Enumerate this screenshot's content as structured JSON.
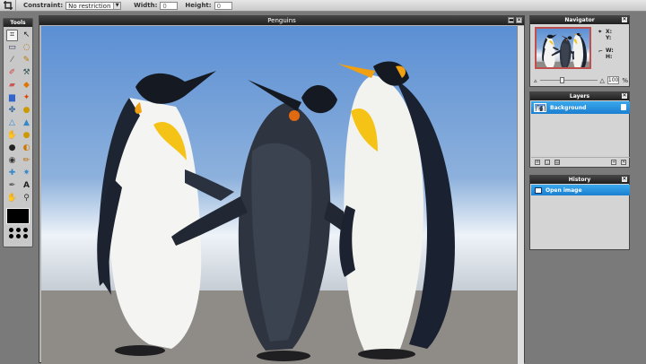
{
  "options": {
    "constraint_label": "Constraint:",
    "constraint_value": "No restriction",
    "width_label": "Width:",
    "width_value": "0",
    "height_label": "Height:",
    "height_value": "0"
  },
  "tools": {
    "title": "Tools",
    "icons": [
      "crop-icon",
      "move-icon",
      "marquee-icon",
      "lasso-icon",
      "wand-icon",
      "pencil-icon",
      "brush-icon",
      "clone-stamp-icon",
      "eraser-icon",
      "fill-bucket-icon",
      "gradient-icon",
      "color-replace-icon",
      "sponge-icon",
      "drop-icon",
      "sharpen-icon",
      "blur-icon",
      "smudge-icon",
      "dodge-icon",
      "burn-icon",
      "red-eye-icon",
      "bloat-icon",
      "pinch-icon",
      "eyedropper-icon",
      "text-icon",
      "hand-icon",
      "zoom-icon"
    ]
  },
  "canvas": {
    "title": "Penguins"
  },
  "navigator": {
    "title": "Navigator",
    "x_label": "X:",
    "y_label": "Y:",
    "w_label": "W:",
    "h_label": "H:",
    "zoom_value": "100",
    "zoom_unit": "%"
  },
  "layers": {
    "title": "Layers",
    "items": [
      {
        "name": "Background"
      }
    ]
  },
  "history": {
    "title": "History",
    "items": [
      {
        "name": "Open image"
      }
    ]
  },
  "colors": {
    "titlebar": "#2a2a2a",
    "selection": "#1f86d6",
    "panel": "#d4d4d4",
    "workspace": "#7a7a7a"
  }
}
